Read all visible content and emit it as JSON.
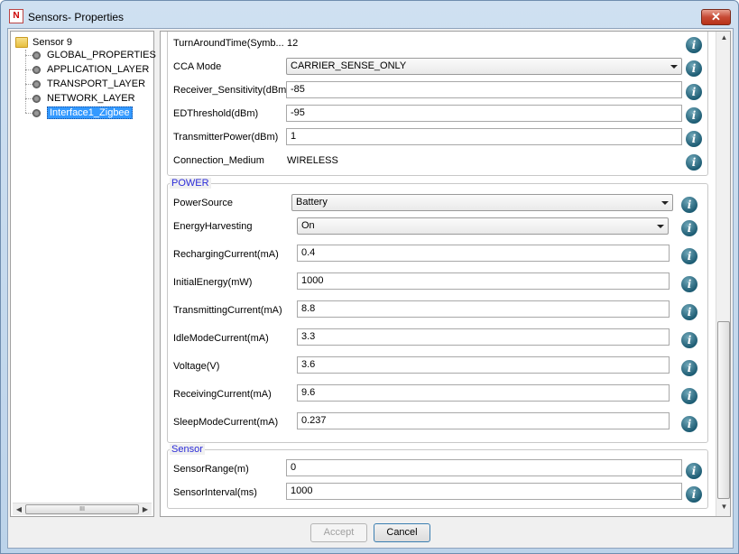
{
  "window": {
    "title": "Sensors- Properties",
    "close_symbol": "✕"
  },
  "tree": {
    "root": "Sensor 9",
    "items": [
      {
        "label": "GLOBAL_PROPERTIES"
      },
      {
        "label": "APPLICATION_LAYER"
      },
      {
        "label": "TRANSPORT_LAYER"
      },
      {
        "label": "NETWORK_LAYER"
      },
      {
        "label": "Interface1_Zigbee"
      }
    ],
    "scroll_grip": "III"
  },
  "top_section": {
    "rows": [
      {
        "label": "TurnAroundTime(Symb...",
        "value": "12"
      },
      {
        "label": "CCA Mode",
        "value": "CARRIER_SENSE_ONLY"
      },
      {
        "label": "Receiver_Sensitivity(dBm)",
        "value": "-85"
      },
      {
        "label": "EDThreshold(dBm)",
        "value": "-95"
      },
      {
        "label": "TransmitterPower(dBm)",
        "value": "1"
      },
      {
        "label": "Connection_Medium",
        "value": "WIRELESS"
      }
    ]
  },
  "power": {
    "title": "POWER",
    "rows": [
      {
        "label": "PowerSource",
        "value": "Battery"
      },
      {
        "label": "EnergyHarvesting",
        "value": "On"
      },
      {
        "label": "RechargingCurrent(mA)",
        "value": "0.4"
      },
      {
        "label": "InitialEnergy(mW)",
        "value": "1000"
      },
      {
        "label": "TransmittingCurrent(mA)",
        "value": "8.8"
      },
      {
        "label": "IdleModeCurrent(mA)",
        "value": "3.3"
      },
      {
        "label": "Voltage(V)",
        "value": "3.6"
      },
      {
        "label": "ReceivingCurrent(mA)",
        "value": "9.6"
      },
      {
        "label": "SleepModeCurrent(mA)",
        "value": "0.237"
      }
    ]
  },
  "sensor": {
    "title": "Sensor",
    "rows": [
      {
        "label": "SensorRange(m)",
        "value": "0"
      },
      {
        "label": "SensorInterval(ms)",
        "value": "1000"
      }
    ]
  },
  "buttons": {
    "accept": "Accept",
    "cancel": "Cancel"
  },
  "info_glyph": "i",
  "colors": {
    "group_title": "#2b2bd8",
    "selection": "#3399ff"
  }
}
